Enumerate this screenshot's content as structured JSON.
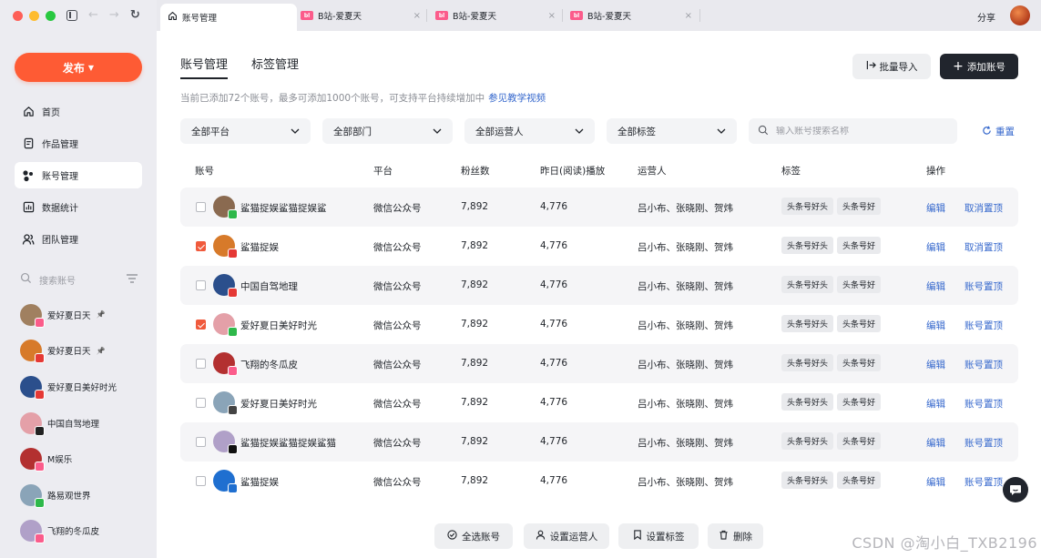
{
  "window": {
    "tabs": [
      {
        "label": "账号管理",
        "active": true
      },
      {
        "label": "B站-爱夏天",
        "active": false
      },
      {
        "label": "B站-爱夏天",
        "active": false
      },
      {
        "label": "B站-爱夏天",
        "active": false
      }
    ],
    "share_label": "分享"
  },
  "sidebar": {
    "publish_label": "发布",
    "menu": [
      {
        "label": "首页",
        "icon": "home-icon"
      },
      {
        "label": "作品管理",
        "icon": "document-icon"
      },
      {
        "label": "账号管理",
        "icon": "accounts-icon",
        "active": true
      },
      {
        "label": "数据统计",
        "icon": "chart-icon"
      },
      {
        "label": "团队管理",
        "icon": "team-icon"
      }
    ],
    "search_placeholder": "搜索账号",
    "accounts": [
      {
        "name": "爱好夏日天",
        "pinned": true,
        "color": "#a08060",
        "plat": "#fb5c8b"
      },
      {
        "name": "爱好夏日天",
        "pinned": true,
        "color": "#d77a2a",
        "plat": "#e53935"
      },
      {
        "name": "爱好夏日美好时光",
        "pinned": false,
        "color": "#2b4f8c",
        "plat": "#e53935"
      },
      {
        "name": "中国自驾地理",
        "pinned": false,
        "color": "#e4a0a8",
        "plat": "#222222"
      },
      {
        "name": "M娱乐",
        "pinned": false,
        "color": "#b33030",
        "plat": "#fb5c8b"
      },
      {
        "name": "路易观世界",
        "pinned": false,
        "color": "#8aa4b8",
        "plat": "#2eb84a"
      },
      {
        "name": "飞翔的冬瓜皮",
        "pinned": false,
        "color": "#b0a0c8",
        "plat": "#fb5c8b"
      }
    ]
  },
  "main": {
    "tabs": [
      {
        "label": "账号管理",
        "active": true
      },
      {
        "label": "标签管理",
        "active": false
      }
    ],
    "import_label": "批量导入",
    "add_label": "添加账号",
    "hint": "当前已添加72个账号，最多可添加1000个账号，可支持平台持续增加中",
    "hint_link": "参见教学视频",
    "filters": [
      "全部平台",
      "全部部门",
      "全部运营人",
      "全部标签"
    ],
    "search_placeholder": "输入账号搜索名称",
    "reset_label": "重置",
    "columns": {
      "account": "账号",
      "platform": "平台",
      "fans": "粉丝数",
      "plays": "昨日(阅读)播放",
      "operators": "运营人",
      "tags": "标签",
      "actions": "操作"
    },
    "rows": [
      {
        "name": "鲨猫捉娱鲨猫捉娱鲨",
        "platform": "微信公众号",
        "fans": "7,892",
        "plays": "4,776",
        "operators": "吕小布、张晓刚、贺炜",
        "tags": [
          "头条号好头",
          "头条号好"
        ],
        "edit": "编辑",
        "pin": "取消置顶",
        "checked": false,
        "av": "#8a6a50",
        "plat": "#2eb84a"
      },
      {
        "name": "鲨猫捉娱",
        "platform": "微信公众号",
        "fans": "7,892",
        "plays": "4,776",
        "operators": "吕小布、张晓刚、贺炜",
        "tags": [
          "头条号好头",
          "头条号好"
        ],
        "edit": "编辑",
        "pin": "取消置顶",
        "checked": true,
        "av": "#d77a2a",
        "plat": "#e53935"
      },
      {
        "name": "中国自驾地理",
        "platform": "微信公众号",
        "fans": "7,892",
        "plays": "4,776",
        "operators": "吕小布、张晓刚、贺炜",
        "tags": [
          "头条号好头",
          "头条号好"
        ],
        "edit": "编辑",
        "pin": "账号置顶",
        "checked": false,
        "av": "#2b4f8c",
        "plat": "#e53935"
      },
      {
        "name": "爱好夏日美好时光",
        "platform": "微信公众号",
        "fans": "7,892",
        "plays": "4,776",
        "operators": "吕小布、张晓刚、贺炜",
        "tags": [
          "头条号好头",
          "头条号好"
        ],
        "edit": "编辑",
        "pin": "账号置顶",
        "checked": true,
        "av": "#e4a0a8",
        "plat": "#2eb84a"
      },
      {
        "name": "飞翔的冬瓜皮",
        "platform": "微信公众号",
        "fans": "7,892",
        "plays": "4,776",
        "operators": "吕小布、张晓刚、贺炜",
        "tags": [
          "头条号好头",
          "头条号好"
        ],
        "edit": "编辑",
        "pin": "账号置顶",
        "checked": false,
        "av": "#b33030",
        "plat": "#fb5c8b"
      },
      {
        "name": "爱好夏日美好时光",
        "platform": "微信公众号",
        "fans": "7,892",
        "plays": "4,776",
        "operators": "吕小布、张晓刚、贺炜",
        "tags": [
          "头条号好头",
          "头条号好"
        ],
        "edit": "编辑",
        "pin": "账号置顶",
        "checked": false,
        "av": "#8aa4b8",
        "plat": "#444444"
      },
      {
        "name": "鲨猫捉娱鲨猫捉娱鲨猫",
        "platform": "微信公众号",
        "fans": "7,892",
        "plays": "4,776",
        "operators": "吕小布、张晓刚、贺炜",
        "tags": [
          "头条号好头",
          "头条号好"
        ],
        "edit": "编辑",
        "pin": "账号置顶",
        "checked": false,
        "av": "#b0a0c8",
        "plat": "#111111"
      },
      {
        "name": "鲨猫捉娱",
        "platform": "微信公众号",
        "fans": "7,892",
        "plays": "4,776",
        "operators": "吕小布、张晓刚、贺炜",
        "tags": [
          "头条号好头",
          "头条号好"
        ],
        "edit": "编辑",
        "pin": "账号置顶",
        "checked": false,
        "av": "#1f6fd0",
        "plat": "#1f6fd0"
      }
    ],
    "bottom_actions": {
      "select_all": "全选账号",
      "set_operator": "设置运营人",
      "set_tag": "设置标签",
      "delete": "删除"
    }
  },
  "watermark": "CSDN @淘小白_TXB2196",
  "colors": {
    "accent": "#fe5b34",
    "link": "#3366cc",
    "dark_button": "#21252d",
    "checked": "#f05a3c"
  }
}
